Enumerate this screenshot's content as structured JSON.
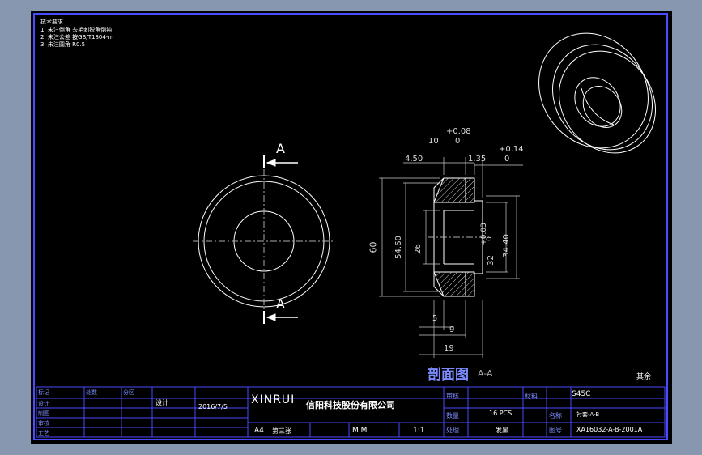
{
  "notes": {
    "title": "技术要求",
    "lines": [
      "1. 未注倒角 去毛刺锐角倒钝",
      "2. 未注公差 按GB/T1804-m",
      "3. 未注圆角 R0.5"
    ]
  },
  "section": {
    "label_top": "A",
    "label_bottom": "A",
    "title": "剖面图",
    "view": "A-A"
  },
  "dimensions": {
    "top_tol_upper": "+0.08",
    "top_tol_lower": "0",
    "top_left": "10",
    "right_tol_upper": "+0.14",
    "right_tol_lower": "0",
    "width_left": "4.50",
    "width_right": "1.35",
    "od": "60",
    "d1": "54.60",
    "d2": "26",
    "bore_tol_upper": "+0.03",
    "bore_tol_lower": "0",
    "bore": "32",
    "d3": "34.40",
    "w1": "5",
    "w2": "9",
    "w3": "19"
  },
  "corner_note": "其余",
  "title_block": {
    "company_en": "XINRUI",
    "company_cn": "信阳科技股份有限公司",
    "date": "2016/7/5",
    "designer": "设计",
    "size": "A4",
    "sheet": "第三张",
    "scale_label": "M.M",
    "scale": "1:1",
    "material_label": "材料",
    "material": "S45C",
    "qty_label": "数量",
    "qty": "16 PCS",
    "part_label": "图号",
    "part_no": "XA16032-A-B-2001A",
    "name_label": "名称",
    "name": "衬套-A-B",
    "process_label": "处理",
    "process": "发黑",
    "check_label": "审核",
    "rev_header": "标记",
    "rev_cols": [
      "处数",
      "分区",
      "更改文件号",
      "签名",
      "年月日"
    ],
    "rows_left": [
      "设计",
      "制图",
      "审核",
      "工艺",
      "批准"
    ]
  }
}
